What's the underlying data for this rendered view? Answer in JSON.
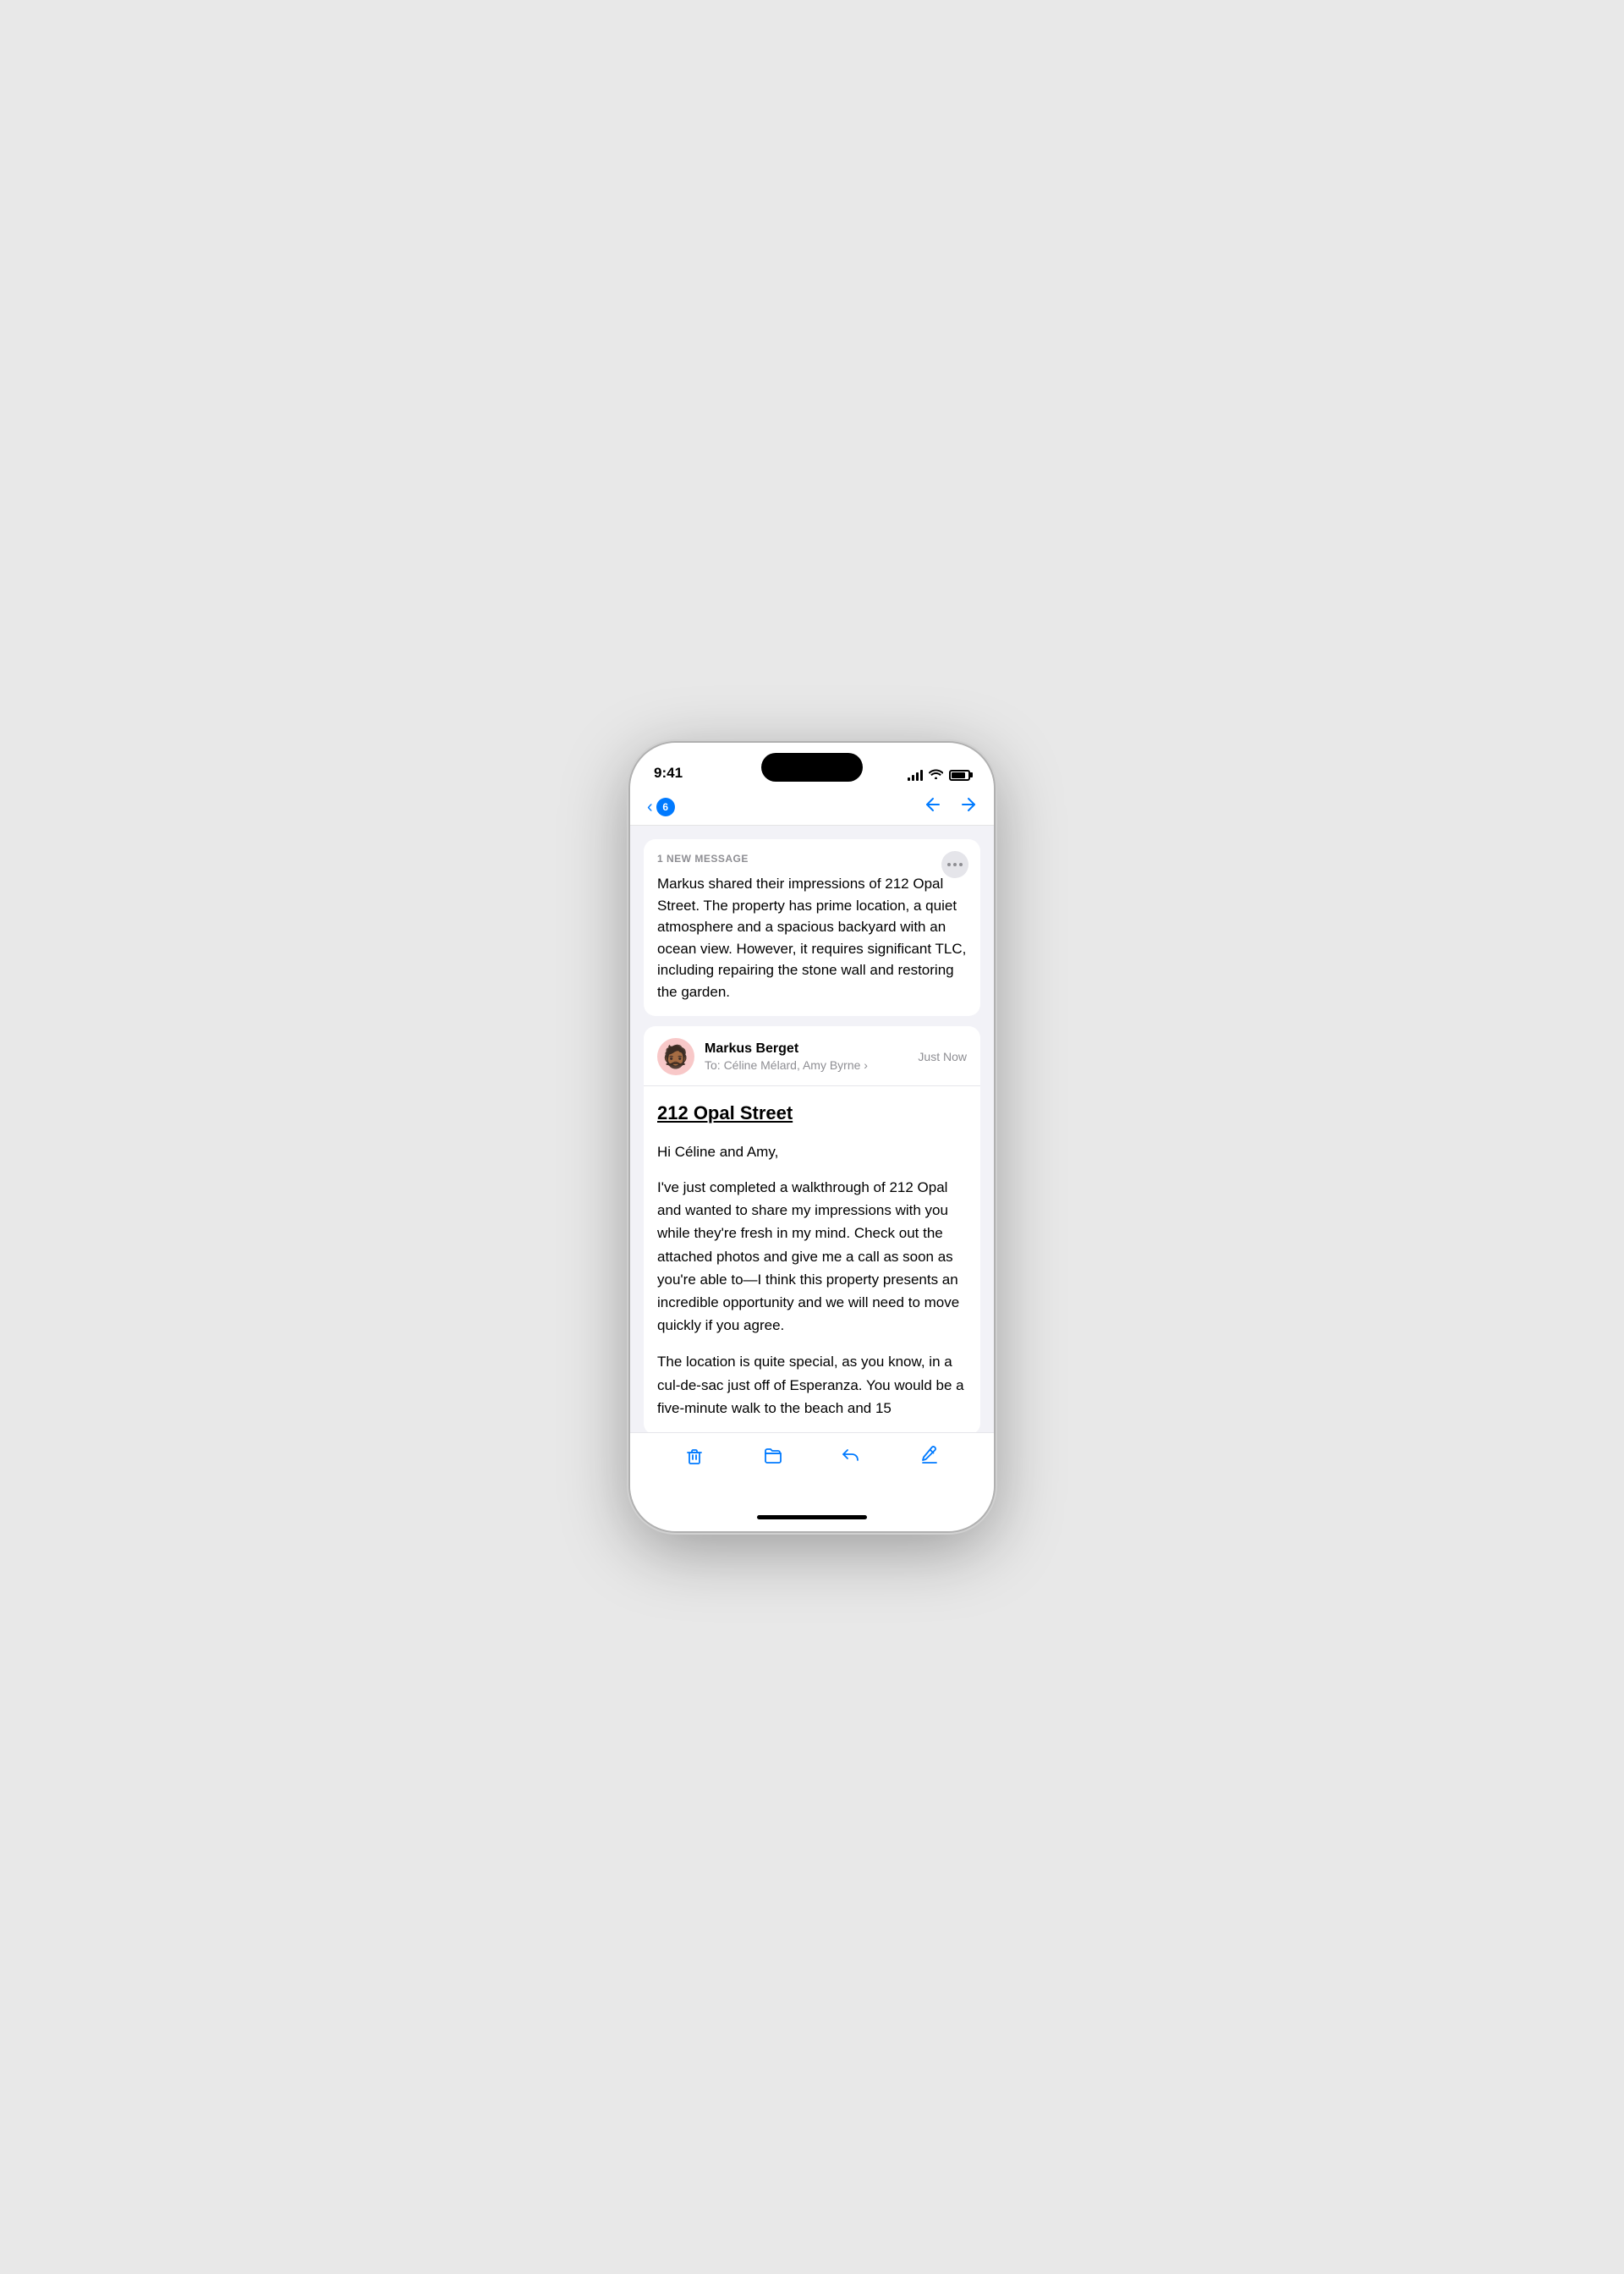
{
  "statusBar": {
    "time": "9:41"
  },
  "navBar": {
    "backLabel": "",
    "badgeCount": "6",
    "upArrow": "↑",
    "downArrow": "↓"
  },
  "summaryCard": {
    "newMessageLabel": "1 NEW MESSAGE",
    "summaryText": "Markus shared their impressions of 212 Opal Street. The property has prime location, a quiet atmosphere and a spacious backyard with an ocean view. However, it requires significant TLC, including repairing the stone wall and restoring the garden.",
    "moreButton": "•••"
  },
  "emailHeader": {
    "senderName": "Markus Berget",
    "time": "Just Now",
    "toLabel": "To: Céline Mélard, Amy Byrne ›",
    "avatarEmoji": "🧔🏾"
  },
  "emailBody": {
    "subject": "212 Opal Street",
    "greeting": "Hi Céline and Amy,",
    "paragraph1": "I've just completed a walkthrough of 212 Opal and wanted to share my impressions with you while they're fresh in my mind. Check out the attached photos and give me a call as soon as you're able to—I think this property presents an incredible opportunity and we will need to move quickly if you agree.",
    "paragraph2Cut": "The location is quite special, as you know, in a cul-de-sac just off of Esperanza. You would be a five-minute walk to the beach and 15"
  },
  "toolbar": {
    "deleteLabel": "Delete",
    "folderLabel": "Folder",
    "replyLabel": "Reply",
    "composeLabel": "Compose"
  }
}
